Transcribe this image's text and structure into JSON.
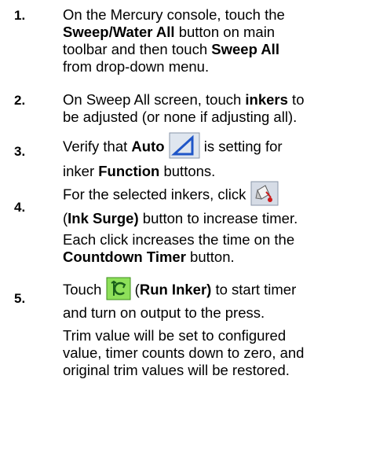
{
  "steps": [
    {
      "number": "1.",
      "lines": [
        [
          "On the Mercury console, touch the"
        ],
        [
          {
            "b": "Sweep/Water All"
          },
          " button on main"
        ],
        [
          "toolbar and then touch ",
          {
            "b": "Sweep All"
          }
        ],
        [
          "from drop-down menu."
        ]
      ]
    },
    {
      "number": "2.",
      "lines": [
        [
          "On Sweep All screen, touch ",
          {
            "b": "inkers"
          },
          " to"
        ],
        [
          "be adjusted (or none if adjusting all)."
        ]
      ]
    },
    {
      "number": "3.",
      "lines": [
        [
          "Verify that ",
          {
            "b": "Auto"
          },
          " ",
          {
            "icon": "auto-delta-icon"
          },
          " is setting for"
        ],
        [
          "inker ",
          {
            "b": "Function"
          },
          " buttons."
        ]
      ]
    },
    {
      "number": "4.",
      "lines": [
        [
          "For the selected inkers, click ",
          {
            "icon": "ink-surge-icon"
          }
        ],
        [
          "(",
          {
            "b": "Ink Surge)"
          },
          " button to increase timer."
        ]
      ],
      "extra": [
        [
          "Each click increases the time on the"
        ],
        [
          {
            "b": "Countdown Timer"
          },
          " button."
        ]
      ]
    },
    {
      "number": "5.",
      "lines": [
        [
          "Touch ",
          {
            "icon": "run-inker-icon"
          },
          " (",
          {
            "b": "Run Inker)"
          },
          " to start timer"
        ],
        [
          "and turn on output to the press."
        ]
      ],
      "extra": [
        [
          "Trim value will be set to configured"
        ],
        [
          "value, timer counts down to zero, and"
        ],
        [
          "original trim values will be restored."
        ]
      ]
    }
  ]
}
